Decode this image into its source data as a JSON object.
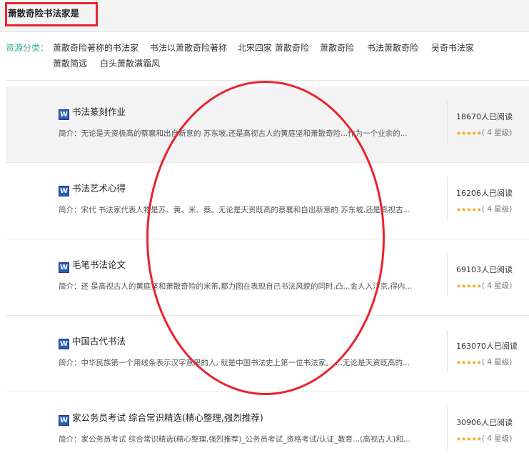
{
  "page": {
    "title": "萧散奇险书法家是"
  },
  "categories": {
    "label": "资源分类：",
    "items": [
      "萧散奇险著称的书法家",
      "书法以萧散奇险著称",
      "北宋四家 萧散奇险",
      "萧散奇险",
      "书法萧散奇险",
      "吴奇书法家",
      "萧散简远",
      "白头萧散满霜风"
    ]
  },
  "results": [
    {
      "title": "书法篆刻作业",
      "desc": "简介：无论是天资极高的蔡襄和出自新意的 苏东坡,还是高视古人的黄庭坚和萧散奇险...作为一个业余的...",
      "reads": "18670人已阅读",
      "rating": "( 4 星级)",
      "stars": 4
    },
    {
      "title": "书法艺术心得",
      "desc": "简介：宋代 书法家代表人物是苏、黄、米、蔡。无论是天资既高的蔡襄和自出新意的 苏东坡,还是高视古...",
      "reads": "16206人已阅读",
      "rating": "( 4 星级)",
      "stars": 4
    },
    {
      "title": "毛笔书法论文",
      "desc": "简介：还 是高视古人的黄庭坚和萧散奇险的米芾,都力图在表现自己书法风貌的同时,凸...金人入汴京,得内...",
      "reads": "69103人已阅读",
      "rating": "( 4 星级)",
      "stars": 4
    },
    {
      "title": "中国古代书法",
      "desc": "简介：中华民族第一个用线条表示汉字意思的人, 就是中国书法史上第一位书法家。 ...无论是天资既高的...",
      "reads": "163070人已阅读",
      "rating": "( 4 星级)",
      "stars": 4
    },
    {
      "title": "家公务员考试 综合常识精选(精心整理,强烈推荐)",
      "desc": "简介：家公务员考试 综合常识精选(精心整理,强烈推荐)_公务员考试_资格考试/认证_教育...(高视古人)和...",
      "reads": "30906人已阅读",
      "rating": "( 4 星级)",
      "stars": 4
    }
  ],
  "icons": {
    "doc": "word-doc-icon",
    "doc_glyph": "W",
    "star_glyph": "★★★★★"
  },
  "colors": {
    "annotation_red": "#e8242c",
    "category_label": "#3ba69a",
    "star": "#f39c12"
  }
}
